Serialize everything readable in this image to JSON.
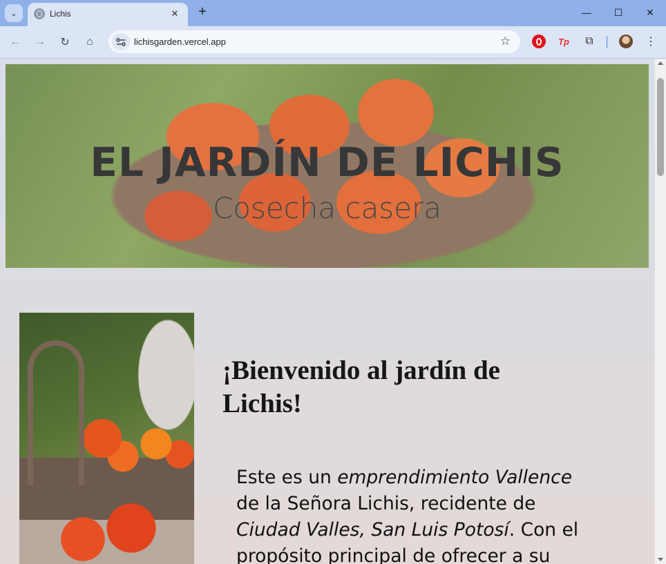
{
  "browser": {
    "tab_title": "Lichis",
    "url": "lichisgarden.vercel.app",
    "icons": {
      "tab_search": "chevron-down-icon",
      "favicon": "globe-icon",
      "close": "close-icon",
      "new_tab": "plus-icon",
      "back": "arrow-left-icon",
      "forward": "arrow-right-icon",
      "reload": "reload-icon",
      "home": "home-icon",
      "site_info": "tune-icon",
      "bookmark": "star-icon",
      "menu": "kebab-menu-icon"
    },
    "glyphs": {
      "tab_search": "⌄",
      "close": "✕",
      "new_tab": "+",
      "back": "←",
      "forward": "→",
      "reload": "↻",
      "home": "⌂",
      "star": "☆",
      "puzzle": "⧉",
      "menu": "⋮",
      "minimize": "—",
      "maximize": "☐",
      "window_close": "✕"
    },
    "extension_tp_label": "Tp"
  },
  "page": {
    "hero_title": "EL JARDÍN DE LICHIS",
    "hero_subtitle": "Cosecha casera",
    "welcome_heading": "¡Bienvenido al jardín de Lichis!",
    "intro": {
      "t1": "Este es un ",
      "t2": "emprendimiento Vallence",
      "t3": " de la Señora Lichis, recidente de ",
      "t4": "Ciudad Valles, San Luis Potosí",
      "t5": ". Con el propósito principal de ofrecer a su"
    }
  },
  "colors": {
    "tabstrip": "#8fb0e8",
    "toolbar": "#dbe5f6",
    "page_background": "#dcdbe0",
    "heading_text": "#161616"
  }
}
